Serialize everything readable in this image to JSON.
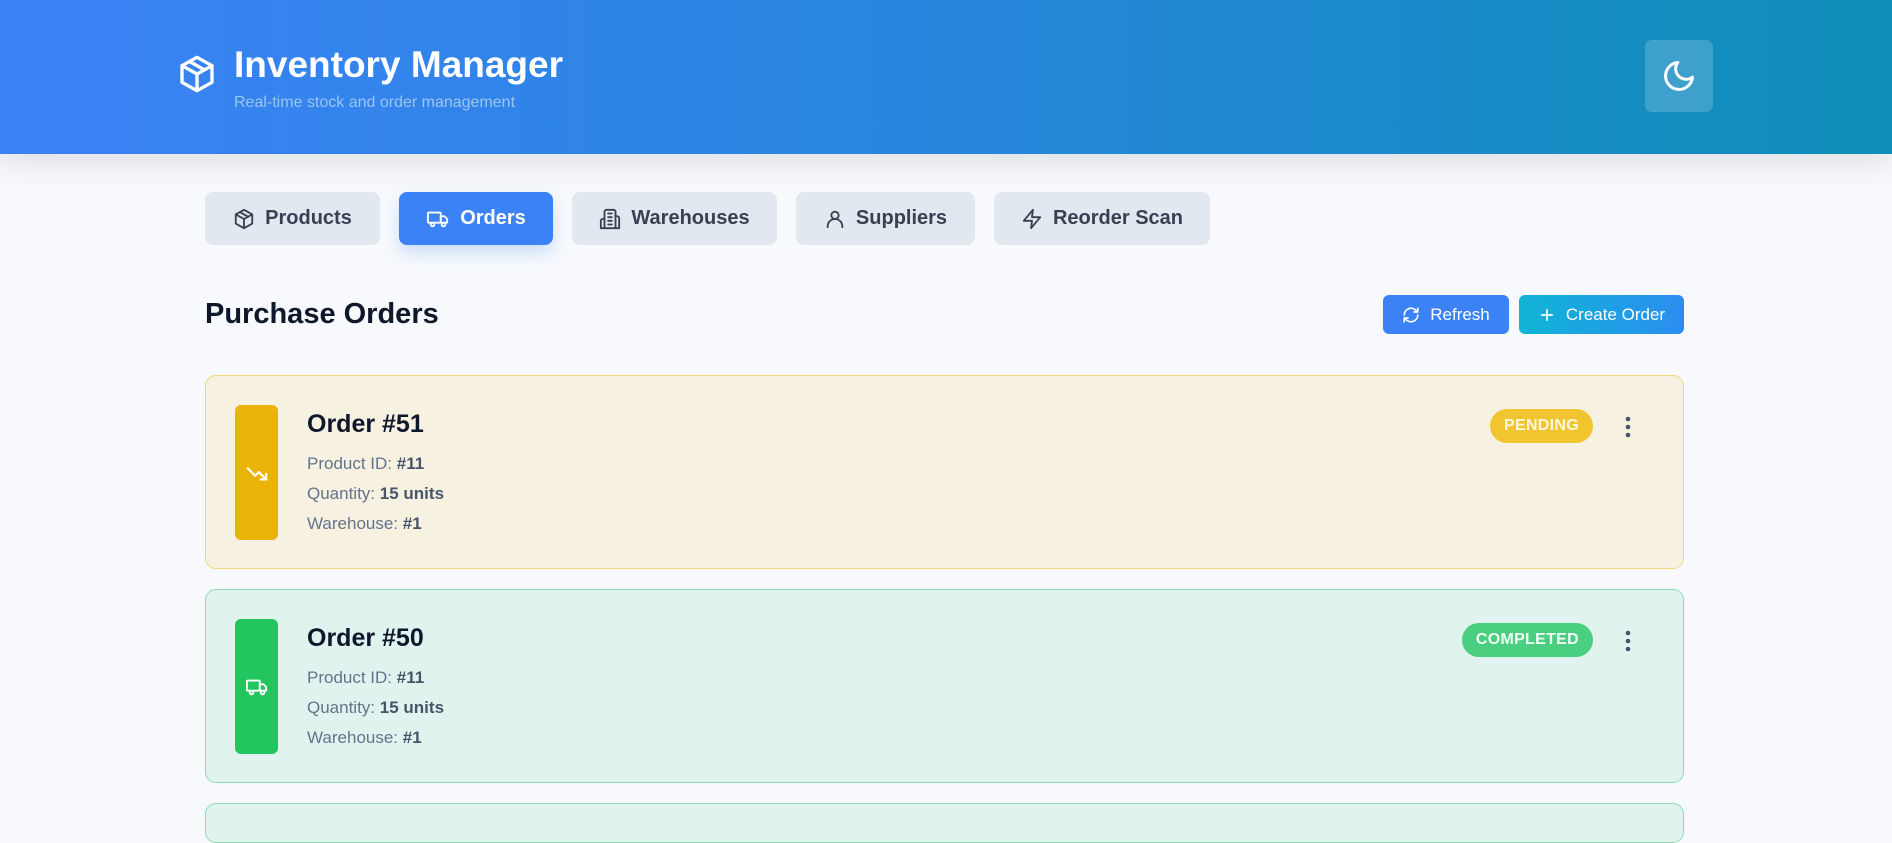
{
  "header": {
    "title": "Inventory Manager",
    "subtitle": "Real-time stock and order management",
    "brand_icon": "package-icon",
    "theme_toggle_icon": "moon-icon"
  },
  "tabs": [
    {
      "label": "Products",
      "icon": "package-icon",
      "active": false
    },
    {
      "label": "Orders",
      "icon": "truck-icon",
      "active": true
    },
    {
      "label": "Warehouses",
      "icon": "building-icon",
      "active": false
    },
    {
      "label": "Suppliers",
      "icon": "user-icon",
      "active": false
    },
    {
      "label": "Reorder Scan",
      "icon": "zap-icon",
      "active": false
    }
  ],
  "section": {
    "title": "Purchase Orders",
    "refresh_label": "Refresh",
    "create_label": "Create Order"
  },
  "orders": [
    {
      "title": "Order #51",
      "status": "PENDING",
      "status_icon": "trending-down-icon",
      "product_label": "Product ID:",
      "product_value": "#11",
      "quantity_label": "Quantity:",
      "quantity_value": "15 units",
      "warehouse_label": "Warehouse:",
      "warehouse_value": "#1"
    },
    {
      "title": "Order #50",
      "status": "COMPLETED",
      "status_icon": "truck-icon",
      "product_label": "Product ID:",
      "product_value": "#11",
      "quantity_label": "Quantity:",
      "quantity_value": "15 units",
      "warehouse_label": "Warehouse:",
      "warehouse_value": "#1"
    }
  ],
  "colors": {
    "header_start": "#3b82f6",
    "header_end": "#0e8eb8",
    "accent": "#3b82f6",
    "pending": "#eab308",
    "completed": "#22c55e"
  }
}
